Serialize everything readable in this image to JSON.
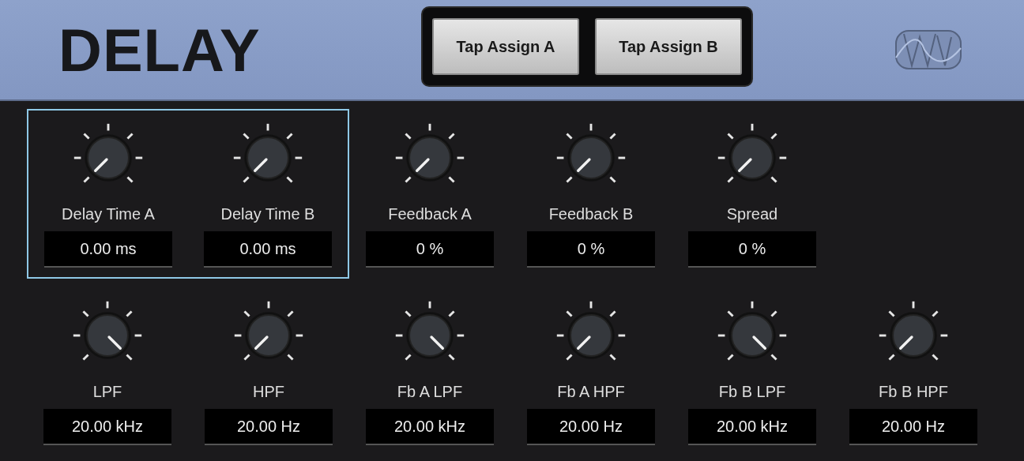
{
  "header": {
    "title": "DELAY",
    "buttons": [
      "Tap Assign A",
      "Tap Assign B"
    ]
  },
  "rows": [
    {
      "knobs": [
        {
          "label": "Delay Time A",
          "value": "0.00 ms",
          "kind": "min",
          "selected": true
        },
        {
          "label": "Delay Time B",
          "value": "0.00 ms",
          "kind": "min",
          "selected": true
        },
        {
          "label": "Feedback A",
          "value": "0 %",
          "kind": "min",
          "selected": false
        },
        {
          "label": "Feedback B",
          "value": "0 %",
          "kind": "min",
          "selected": false
        },
        {
          "label": "Spread",
          "value": "0 %",
          "kind": "min",
          "selected": false
        }
      ]
    },
    {
      "knobs": [
        {
          "label": "LPF",
          "value": "20.00 kHz",
          "kind": "max",
          "selected": false
        },
        {
          "label": "HPF",
          "value": "20.00 Hz",
          "kind": "min",
          "selected": false
        },
        {
          "label": "Fb A LPF",
          "value": "20.00 kHz",
          "kind": "max",
          "selected": false
        },
        {
          "label": "Fb A HPF",
          "value": "20.00 Hz",
          "kind": "min",
          "selected": false
        },
        {
          "label": "Fb B LPF",
          "value": "20.00 kHz",
          "kind": "max",
          "selected": false
        },
        {
          "label": "Fb B HPF",
          "value": "20.00 Hz",
          "kind": "min",
          "selected": false
        }
      ]
    }
  ]
}
